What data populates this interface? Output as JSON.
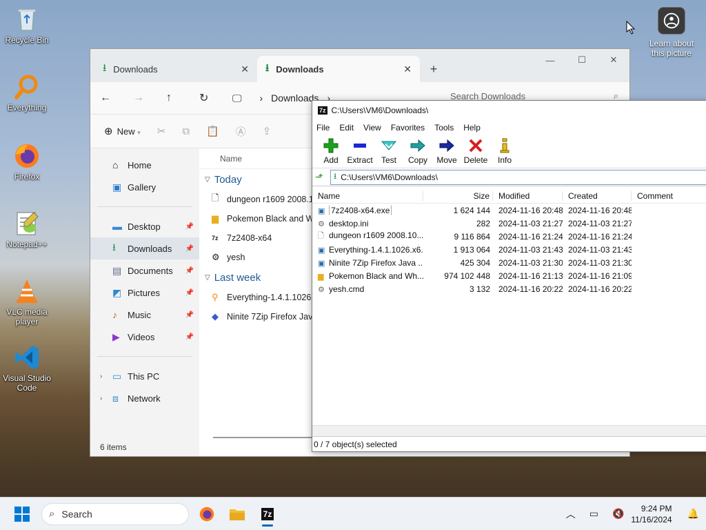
{
  "desktop": {
    "icons": [
      {
        "label": "Recycle Bin"
      },
      {
        "label": "Everything"
      },
      {
        "label": "Firefox"
      },
      {
        "label": "Notepad++"
      },
      {
        "label": "VLC media player"
      },
      {
        "label": "Visual Studio Code"
      }
    ],
    "learn": {
      "label": "Learn about this picture"
    }
  },
  "explorer": {
    "tabs": [
      {
        "label": "Downloads"
      },
      {
        "label": "Downloads"
      }
    ],
    "address": {
      "segment": "Downloads"
    },
    "search": {
      "placeholder": "Search Downloads"
    },
    "cmd": {
      "new_label": "New"
    },
    "sidebar": {
      "home": "Home",
      "gallery": "Gallery",
      "desktop": "Desktop",
      "downloads": "Downloads",
      "documents": "Documents",
      "pictures": "Pictures",
      "music": "Music",
      "videos": "Videos",
      "thispc": "This PC",
      "network": "Network"
    },
    "column_name": "Name",
    "groups": {
      "today": "Today",
      "lastweek": "Last week"
    },
    "today_items": [
      {
        "name": "dungeon r1609 2008.10."
      },
      {
        "name": "Pokemon Black and Wh"
      },
      {
        "name": "7z2408-x64"
      },
      {
        "name": "yesh"
      }
    ],
    "lastweek_items": [
      {
        "name": "Everything-1.4.1.1026.x6"
      },
      {
        "name": "Ninite 7Zip Firefox Java"
      }
    ],
    "status": "6 items"
  },
  "sevenzip": {
    "title": "C:\\Users\\VM6\\Downloads\\",
    "menu": [
      "File",
      "Edit",
      "View",
      "Favorites",
      "Tools",
      "Help"
    ],
    "tools": [
      "Add",
      "Extract",
      "Test",
      "Copy",
      "Move",
      "Delete",
      "Info"
    ],
    "path": "C:\\Users\\VM6\\Downloads\\",
    "columns": {
      "name": "Name",
      "size": "Size",
      "modified": "Modified",
      "created": "Created",
      "comment": "Comment"
    },
    "rows": [
      {
        "name": "7z2408-x64.exe",
        "size": "1 624 144",
        "modified": "2024-11-16 20:48",
        "created": "2024-11-16 20:48"
      },
      {
        "name": "desktop.ini",
        "size": "282",
        "modified": "2024-11-03 21:27",
        "created": "2024-11-03 21:27"
      },
      {
        "name": "dungeon r1609 2008.10....",
        "size": "9 116 864",
        "modified": "2024-11-16 21:24",
        "created": "2024-11-16 21:24"
      },
      {
        "name": "Everything-1.4.1.1026.x6...",
        "size": "1 913 064",
        "modified": "2024-11-03 21:43",
        "created": "2024-11-03 21:43"
      },
      {
        "name": "Ninite 7Zip Firefox Java ...",
        "size": "425 304",
        "modified": "2024-11-03 21:30",
        "created": "2024-11-03 21:30"
      },
      {
        "name": "Pokemon Black and Wh...",
        "size": "974 102 448",
        "modified": "2024-11-16 21:13",
        "created": "2024-11-16 21:09"
      },
      {
        "name": "yesh.cmd",
        "size": "3 132",
        "modified": "2024-11-16 20:22",
        "created": "2024-11-16 20:22"
      }
    ],
    "status": "0 / 7 object(s) selected"
  },
  "taskbar": {
    "search": "Search",
    "time": "9:24 PM",
    "date": "11/16/2024"
  },
  "colors": {
    "accent": "#0067c0",
    "folder_green": "#1a8c4a",
    "add_green": "#19a319",
    "delete_red": "#d81e1e"
  }
}
